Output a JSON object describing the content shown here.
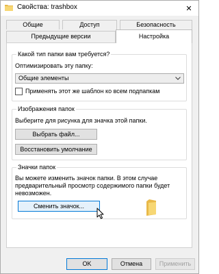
{
  "window": {
    "title": "Свойства: trashbox",
    "close_glyph": "✕"
  },
  "tabs": {
    "row1": [
      "Общие",
      "Доступ",
      "Безопасность"
    ],
    "row2": [
      "Предыдущие версии",
      "Настройка"
    ],
    "active": "Настройка"
  },
  "folder_type": {
    "group_label": "Какой тип папки вам требуется?",
    "optimize_label": "Оптимизировать эту папку:",
    "selected_value": "Общие элементы",
    "apply_checkbox_label": "Применять этот же шаблон ко всем подпапкам",
    "apply_checked": false
  },
  "folder_pictures": {
    "group_label": "Изображения папок",
    "description": "Выберите для рисунка для значка этой папки.",
    "choose_file_button": "Выбрать файл...",
    "restore_default_button": "Восстановить умолчание"
  },
  "folder_icons": {
    "group_label": "Значки папок",
    "description_lines": [
      "Вы можете изменить значок папки. В этом случае",
      "предварительный просмотр содержимого папки будет",
      "невозможен."
    ],
    "change_icon_button": "Сменить значок..."
  },
  "footer": {
    "ok": "OK",
    "cancel": "Отмена",
    "apply": "Применить"
  },
  "colors": {
    "accent": "#0078d7",
    "folder": "#f7d774"
  }
}
